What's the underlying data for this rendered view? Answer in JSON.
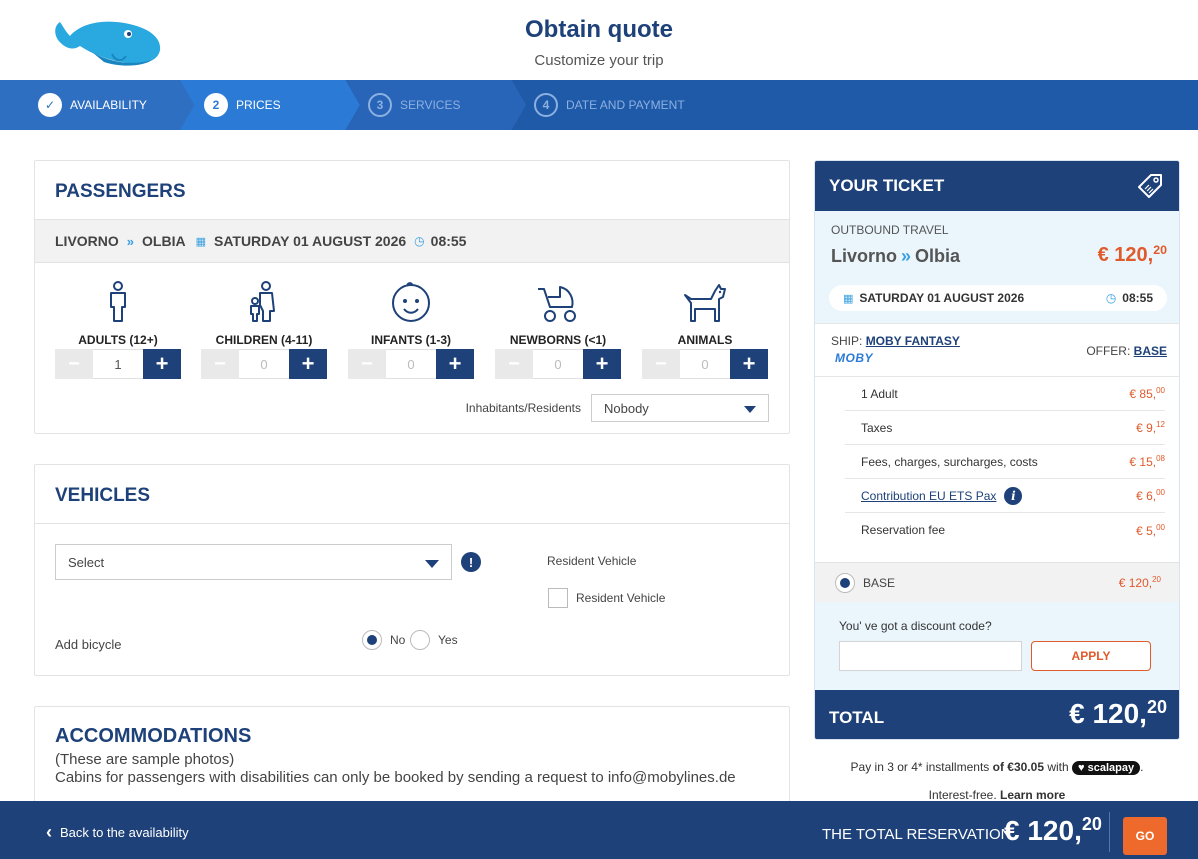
{
  "header": {
    "title": "Obtain quote",
    "subtitle": "Customize your trip",
    "logo_icon": "whale-logo"
  },
  "steps": [
    {
      "num": "✓",
      "label": "AVAILABILITY",
      "state": "done"
    },
    {
      "num": "2",
      "label": "PRICES",
      "state": "active"
    },
    {
      "num": "3",
      "label": "SERVICES",
      "state": "pending"
    },
    {
      "num": "4",
      "label": "DATE AND PAYMENT",
      "state": "pending"
    }
  ],
  "passengers": {
    "title": "PASSENGERS",
    "route": {
      "from": "LIVORNO",
      "to": "OLBIA",
      "date": "SATURDAY 01 AUGUST 2026",
      "time": "08:55"
    },
    "types": [
      {
        "label": "ADULTS (12+)",
        "value": "1",
        "icon": "adult-icon"
      },
      {
        "label": "CHILDREN (4-11)",
        "value": "0",
        "icon": "child-icon"
      },
      {
        "label": "INFANTS (1-3)",
        "value": "0",
        "icon": "infant-icon"
      },
      {
        "label": "NEWBORNS (<1)",
        "value": "0",
        "icon": "stroller-icon"
      },
      {
        "label": "ANIMALS",
        "value": "0",
        "icon": "dog-icon"
      }
    ],
    "residents_label": "Inhabitants/Residents",
    "residents_value": "Nobody"
  },
  "vehicles": {
    "title": "VEHICLES",
    "select_value": "Select",
    "warn_icon": "!",
    "resident_vehicle_label": "Resident Vehicle",
    "resident_vehicle_checkbox_label": "Resident Vehicle",
    "add_bicycle_label": "Add bicycle",
    "no_label": "No",
    "yes_label": "Yes"
  },
  "accommodations": {
    "title": "ACCOMMODATIONS",
    "note1": "(These are sample photos)",
    "note2": "Cabins for passengers with disabilities can only be booked by sending a request to info@mobylines.de"
  },
  "ticket": {
    "title": "YOUR TICKET",
    "outbound_label": "OUTBOUND TRAVEL",
    "from": "Livorno",
    "to": "Olbia",
    "price_int": "€ 120,",
    "price_dec": "20",
    "date": "SATURDAY 01 AUGUST 2026",
    "time": "08:55",
    "ship_label": "SHIP:",
    "ship_name": "MOBY FANTASY",
    "ship_brand": "MOBY",
    "offer_label": "OFFER:",
    "offer_name": "BASE",
    "lines": [
      {
        "label": "1 Adult",
        "int": "€ 85,",
        "dec": "00"
      },
      {
        "label": "Taxes",
        "int": "€ 9,",
        "dec": "12"
      },
      {
        "label": "Fees, charges, surcharges, costs",
        "int": "€ 15,",
        "dec": "08"
      },
      {
        "label": "Contribution EU ETS Pax",
        "int": "€ 6,",
        "dec": "00"
      },
      {
        "label": "Reservation fee",
        "int": "€ 5,",
        "dec": "00"
      }
    ],
    "info_icon": "i",
    "base_label": "BASE",
    "base_int": "€ 120,",
    "base_dec": "20",
    "discount_label": "You' ve got a discount code?",
    "apply_label": "APPLY",
    "total_label": "TOTAL",
    "total_int": "€ 120,",
    "total_dec": "20"
  },
  "payment": {
    "line1_a": "Pay in 3 or 4* installments",
    "line1_b": "of €30.05",
    "line1_c": "with",
    "brand": "♥ scalapay",
    "line1_d": ".",
    "line2_a": "Interest-free.",
    "line2_b": "Learn more"
  },
  "footer": {
    "back_label": "Back to the availability",
    "total_label": "THE TOTAL RESERVATION",
    "total_int": "€ 120,",
    "total_dec": "20",
    "go_label": "GO"
  },
  "colors": {
    "primary": "#1d4178",
    "accent": "#ee6a2c",
    "price": "#e05a2b",
    "highlight": "#3aa0e0"
  }
}
